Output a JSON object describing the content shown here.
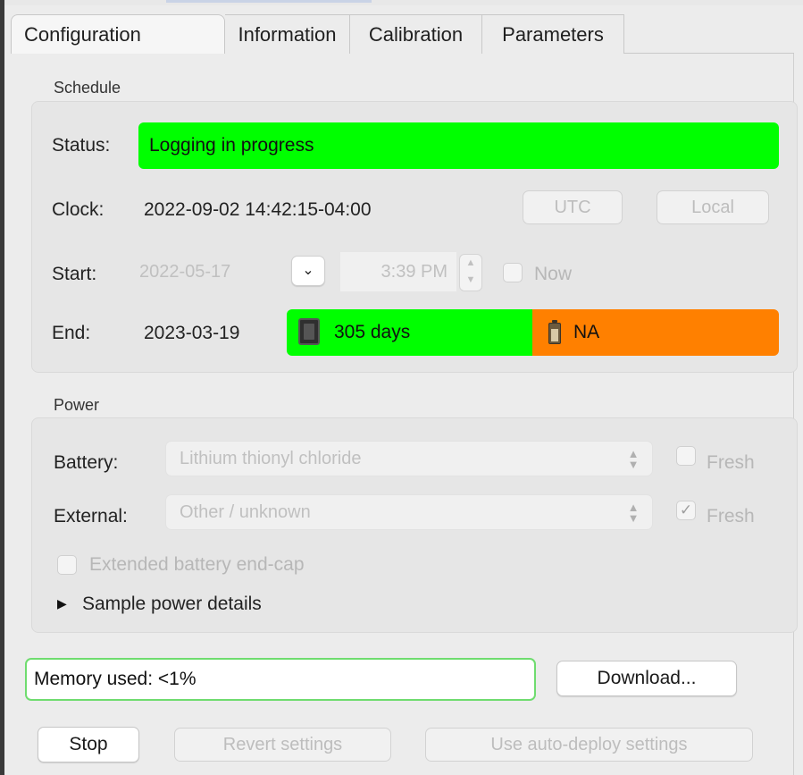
{
  "tabs": [
    {
      "label": "Configuration"
    },
    {
      "label": "Information"
    },
    {
      "label": "Calibration"
    },
    {
      "label": "Parameters"
    }
  ],
  "schedule": {
    "title": "Schedule",
    "status_label": "Status:",
    "status_value": "Logging in progress",
    "clock_label": "Clock:",
    "clock_value": "2022-09-02 14:42:15-04:00",
    "utc_button": "UTC",
    "local_button": "Local",
    "start_label": "Start:",
    "start_date": "2022-05-17",
    "start_time": "3:39 PM",
    "now_label": "Now",
    "end_label": "End:",
    "end_date": "2023-03-19",
    "memory_days": "305 days",
    "battery_days": "NA"
  },
  "power": {
    "title": "Power",
    "battery_label": "Battery:",
    "battery_value": "Lithium thionyl chloride",
    "battery_fresh_label": "Fresh",
    "battery_fresh_checked": false,
    "external_label": "External:",
    "external_value": "Other / unknown",
    "external_fresh_label": "Fresh",
    "external_fresh_checked": true,
    "extended_endcap_label": "Extended battery end-cap",
    "sample_power_label": "Sample power details"
  },
  "memory_used": "Memory used: <1%",
  "download_button": "Download...",
  "actions": {
    "stop": "Stop",
    "revert": "Revert settings",
    "auto_deploy": "Use auto-deploy settings"
  },
  "colors": {
    "status_green": "#00ff00",
    "battery_orange": "#ff8000",
    "memory_border": "#6fdc6f"
  }
}
